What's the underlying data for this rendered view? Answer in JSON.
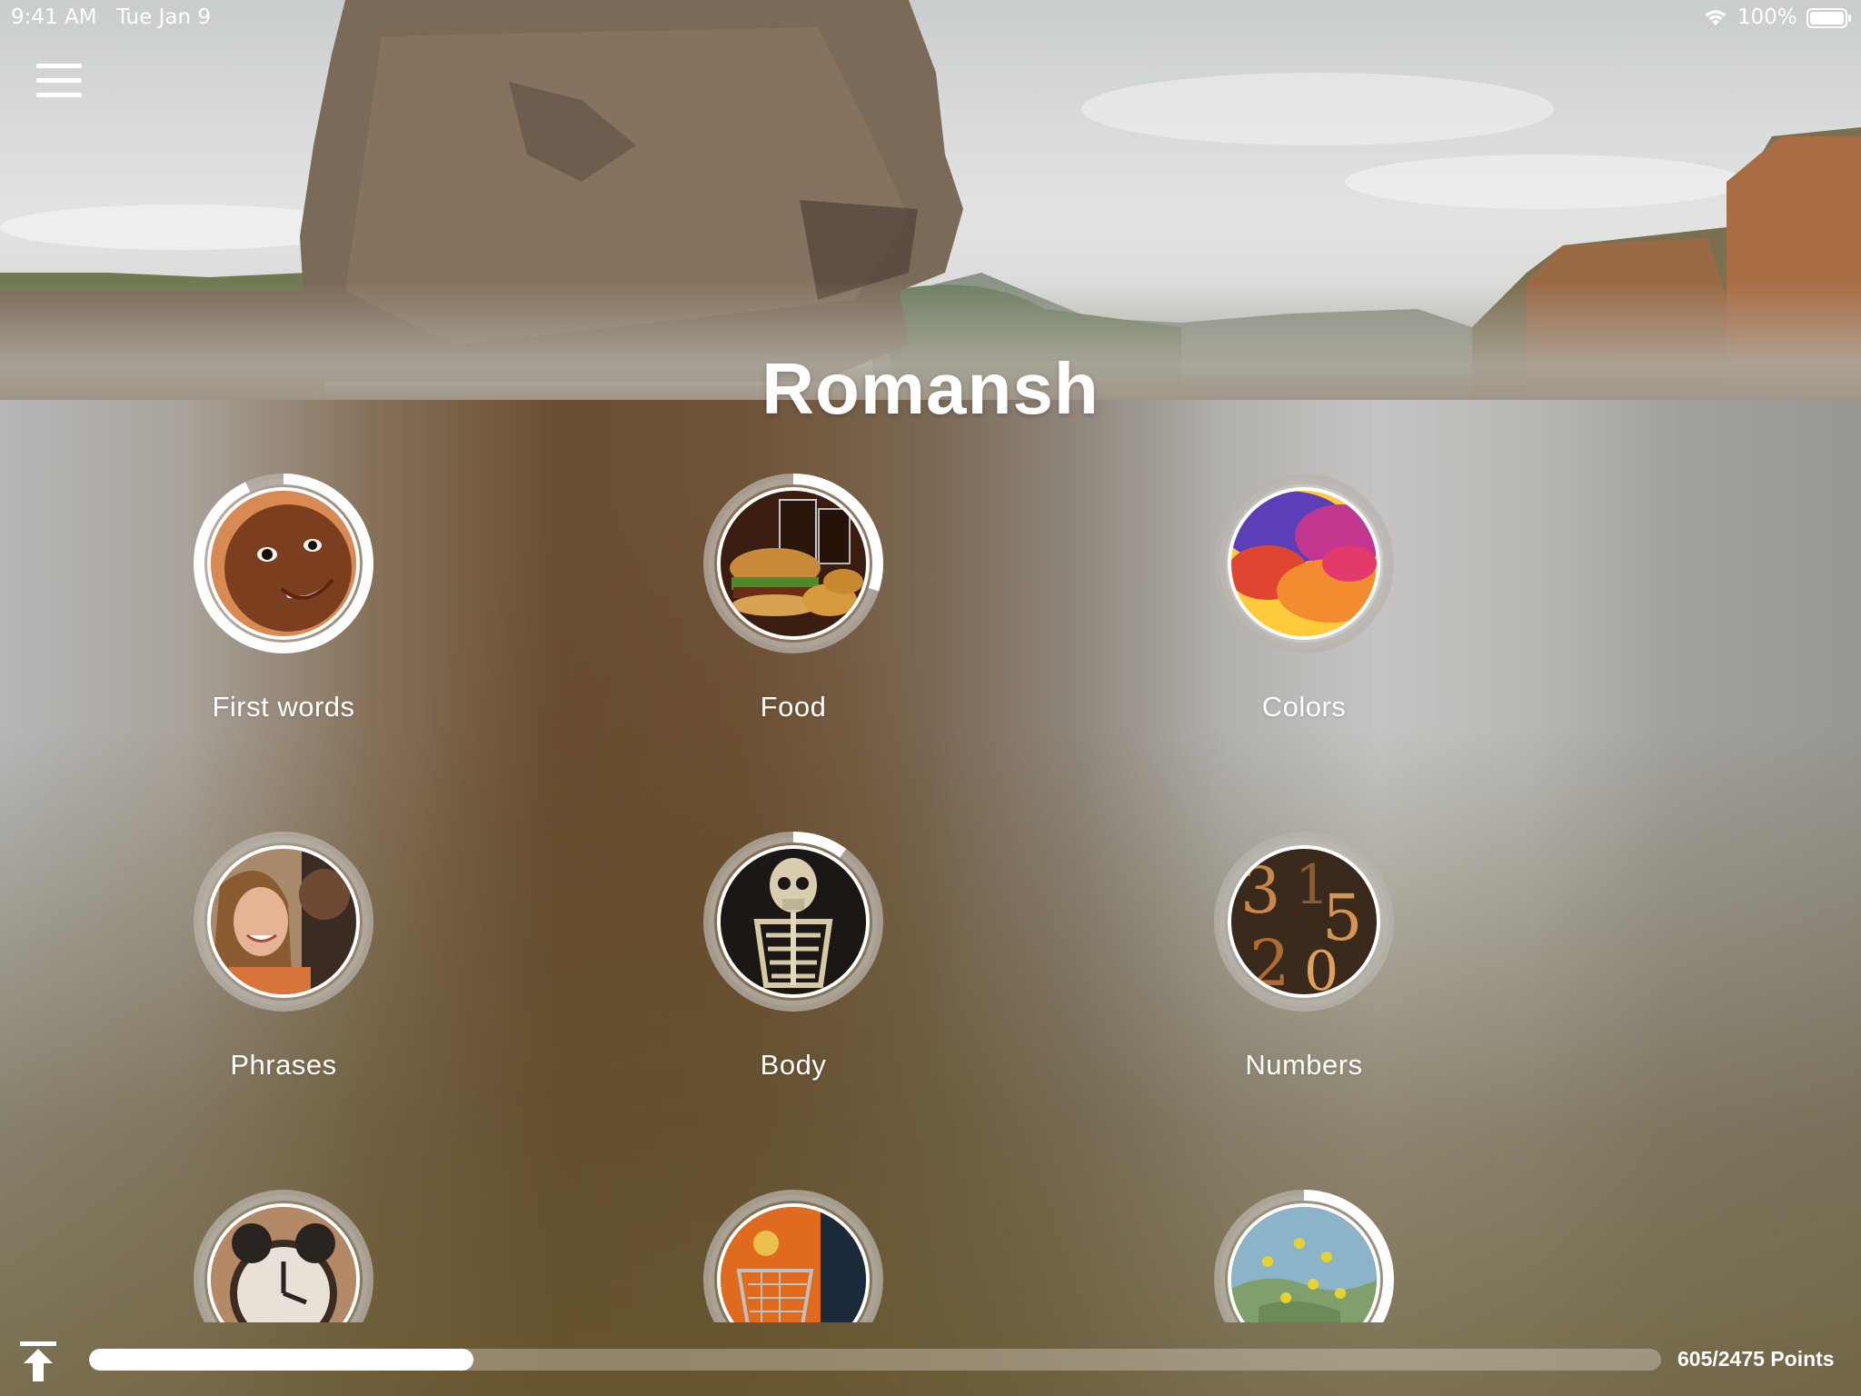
{
  "status_bar": {
    "time": "9:41 AM",
    "date": "Tue Jan 9",
    "battery_percent": "100%",
    "icons": [
      "wifi-icon",
      "battery-icon"
    ]
  },
  "header": {
    "menu_icon": "hamburger-menu-icon",
    "title": "Romansh"
  },
  "topics": [
    {
      "label": "First words",
      "progress": 0.93,
      "image": "smiling-baby"
    },
    {
      "label": "Food",
      "progress": 0.3,
      "image": "burger-and-cola"
    },
    {
      "label": "Colors",
      "progress": 0.0,
      "image": "colorful-powder"
    },
    {
      "label": "Phrases",
      "progress": 0.0,
      "image": "smiling-woman"
    },
    {
      "label": "Body",
      "progress": 0.1,
      "image": "skeleton"
    },
    {
      "label": "Numbers",
      "progress": 0.0,
      "image": "wooden-numbers"
    },
    {
      "label": "",
      "progress": 0.0,
      "image": "alarm-clock"
    },
    {
      "label": "",
      "progress": 0.0,
      "image": "shopping-cart"
    },
    {
      "label": "",
      "progress": 0.55,
      "image": "map-with-pins"
    }
  ],
  "footer": {
    "scroll_top_icon": "scroll-to-top-icon",
    "points_earned": 605,
    "points_total": 2475,
    "points_text": "605/2475 Points",
    "progress_fraction": 0.2444
  },
  "colors": {
    "ring_track": "#b8b3ab",
    "ring_progress": "#ffffff",
    "text": "#ffffff"
  }
}
